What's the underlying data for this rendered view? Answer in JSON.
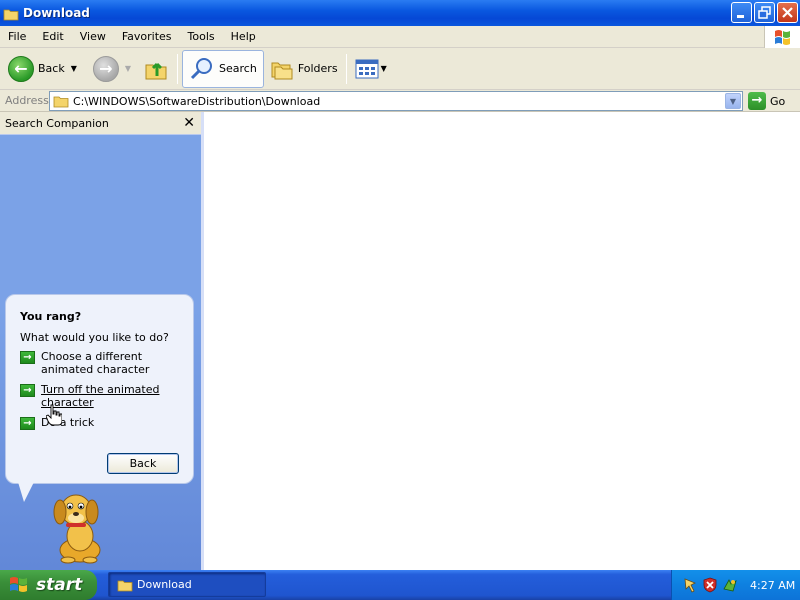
{
  "window": {
    "title": "Download",
    "buttons": [
      "minimize-icon",
      "restore-icon",
      "close-icon"
    ]
  },
  "menubar": {
    "items": [
      "File",
      "Edit",
      "View",
      "Favorites",
      "Tools",
      "Help"
    ]
  },
  "toolbar": {
    "back_label": "Back",
    "search_label": "Search",
    "folders_label": "Folders"
  },
  "address": {
    "label": "Address",
    "value": "C:\\WINDOWS\\SoftwareDistribution\\Download",
    "go_label": "Go"
  },
  "search_companion": {
    "title": "Search Companion",
    "balloon": {
      "title": "You rang?",
      "question": "What would you like to do?",
      "options": [
        "Choose a different animated character",
        "Turn off the animated character",
        "Do a trick"
      ],
      "back_button": "Back"
    }
  },
  "taskbar": {
    "start_label": "start",
    "task_label": "Download",
    "clock": "4:27 AM"
  },
  "colors": {
    "title_bar": "#0a58e0",
    "pane_blue": "#7ba2e7",
    "taskbar": "#245edb",
    "start_green": "#3a8f39"
  }
}
